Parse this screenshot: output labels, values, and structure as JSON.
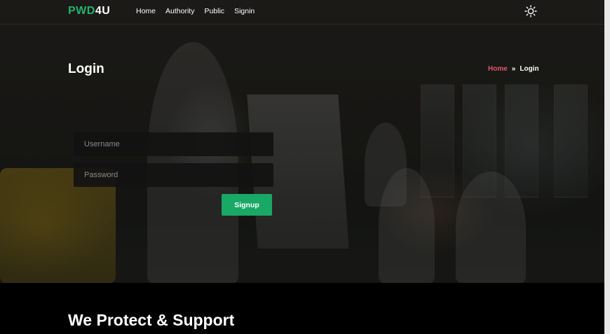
{
  "brand": {
    "accent": "PWD",
    "rest": "4U"
  },
  "nav": {
    "items": [
      "Home",
      "Authority",
      "Public",
      "Signin"
    ]
  },
  "theme_toggle": {
    "icon": "sun-icon"
  },
  "hero": {
    "title": "Login"
  },
  "breadcrumb": {
    "home": "Home",
    "separator": "»",
    "current": "Login"
  },
  "form": {
    "username_placeholder": "Username",
    "password_placeholder": "Password",
    "submit_label": "Signup"
  },
  "section": {
    "heading": "We Protect & Support"
  },
  "colors": {
    "accent": "#21b36a",
    "button": "#19a866",
    "breadcrumb_home": "#e0566a"
  }
}
